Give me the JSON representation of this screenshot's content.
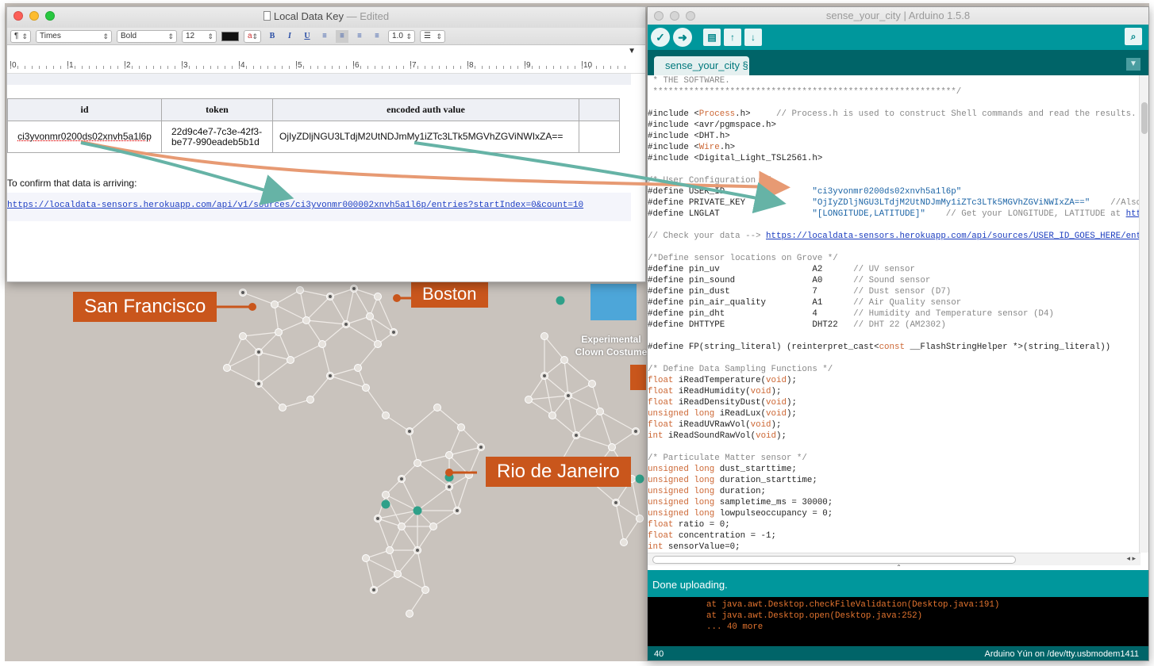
{
  "textedit": {
    "title": "Local Data Key",
    "status": "Edited",
    "format_bar": {
      "paragraph": "¶",
      "font_family": "Times",
      "font_style": "Bold",
      "font_size": "12",
      "bold": "B",
      "italic": "I",
      "underline": "U",
      "line_spacing": "1.0"
    },
    "ruler_numbers": [
      "0",
      "1",
      "2",
      "3",
      "4",
      "5",
      "6",
      "7",
      "8",
      "9",
      "10"
    ],
    "table": {
      "headers": [
        "id",
        "token",
        "encoded auth value",
        ""
      ],
      "row": [
        "ci3yvonmr0200ds02xnvh5a1l6p",
        "22d9c4e7-7c3e-42f3-be77-990eadeb5b1d",
        "OjIyZDljNGU3LTdjM2UtNDJmMy1iZTc3LTk5MGVhZGViNWIxZA==",
        ""
      ]
    },
    "confirm_text": "To confirm that data is arriving:",
    "confirm_link": "https://localdata-sensors.herokuapp.com/api/v1/sources/ci3yvonmr000002xnvh5a1l6p/entries?startIndex=0&count=10"
  },
  "map": {
    "labels": [
      "San Francisco",
      "Boston",
      "Rio de Janeiro"
    ],
    "note_line1": "Experimental",
    "note_line2": "Clown Costume",
    "colors": {
      "callout": "#c9561c",
      "background": "#c9c3bd",
      "node": "#e6e2dd",
      "node_dark": "#5a5a5a",
      "teal": "#2fa089"
    }
  },
  "arduino": {
    "title": "sense_your_city | Arduino 1.5.8",
    "tab": "sense_your_city §",
    "toolbar": [
      "verify-icon",
      "upload-icon",
      "new-icon",
      "open-icon",
      "save-icon",
      "serial-monitor-icon"
    ],
    "code_lines": [
      [
        {
          "t": " * THE SOFTWARE.",
          "c": "#888"
        }
      ],
      [
        {
          "t": " ***********************************************************/",
          "c": "#888"
        }
      ],
      [
        {
          "t": "",
          "c": "#222"
        }
      ],
      [
        {
          "t": "#include <",
          "c": "#222"
        },
        {
          "t": "Process",
          "c": "#cc6633"
        },
        {
          "t": ".h>     ",
          "c": "#222"
        },
        {
          "t": "// Process.h is used to construct Shell commands and read the results.",
          "c": "#888"
        }
      ],
      [
        {
          "t": "#include <avr/pgmspace.h>",
          "c": "#222"
        }
      ],
      [
        {
          "t": "#include <DHT.h>",
          "c": "#222"
        }
      ],
      [
        {
          "t": "#include <",
          "c": "#222"
        },
        {
          "t": "Wire",
          "c": "#cc6633"
        },
        {
          "t": ".h>",
          "c": "#222"
        }
      ],
      [
        {
          "t": "#include <Digital_Light_TSL2561.h>",
          "c": "#222"
        }
      ],
      [
        {
          "t": "",
          "c": "#222"
        }
      ],
      [
        {
          "t": "/* User Configuration */",
          "c": "#888"
        }
      ],
      [
        {
          "t": "#define USER_ID                 ",
          "c": "#222"
        },
        {
          "t": "\"ci3yvonmr0200ds02xnvh5a1l6p\"",
          "c": "#1a63a5"
        }
      ],
      [
        {
          "t": "#define PRIVATE_KEY             ",
          "c": "#222"
        },
        {
          "t": "\"OjIyZDljNGU3LTdjM2UtNDJmMy1iZTc3LTk5MGVhZGViNWIxZA==\"",
          "c": "#1a63a5"
        },
        {
          "t": "    //Also known as \"",
          "c": "#888"
        }
      ],
      [
        {
          "t": "#define LNGLAT                  ",
          "c": "#222"
        },
        {
          "t": "\"[LONGITUDE,LATITUDE]\"",
          "c": "#1a63a5"
        },
        {
          "t": "    // Get your LONGITUDE, LATITUDE at ",
          "c": "#888"
        },
        {
          "t": "http://mygeopo",
          "c": "#1a3cbf",
          "u": true
        }
      ],
      [
        {
          "t": "",
          "c": "#222"
        }
      ],
      [
        {
          "t": "// Check your data --> ",
          "c": "#888"
        },
        {
          "t": "https://localdata-sensors.herokuapp.com/api/sources/USER_ID_GOES_HERE/entries?st",
          "c": "#1a3cbf",
          "u": true
        }
      ],
      [
        {
          "t": "",
          "c": "#222"
        }
      ],
      [
        {
          "t": "/*Define sensor locations on Grove */",
          "c": "#888"
        }
      ],
      [
        {
          "t": "#define pin_uv                  A2      ",
          "c": "#222"
        },
        {
          "t": "// UV sensor",
          "c": "#888"
        }
      ],
      [
        {
          "t": "#define pin_sound               A0      ",
          "c": "#222"
        },
        {
          "t": "// Sound sensor",
          "c": "#888"
        }
      ],
      [
        {
          "t": "#define pin_dust                7       ",
          "c": "#222"
        },
        {
          "t": "// Dust sensor (D7)",
          "c": "#888"
        }
      ],
      [
        {
          "t": "#define pin_air_quality         A1      ",
          "c": "#222"
        },
        {
          "t": "// Air Quality sensor",
          "c": "#888"
        }
      ],
      [
        {
          "t": "#define pin_dht                 4       ",
          "c": "#222"
        },
        {
          "t": "// Humidity and Temperature sensor (D4)",
          "c": "#888"
        }
      ],
      [
        {
          "t": "#define DHTTYPE                 DHT22   ",
          "c": "#222"
        },
        {
          "t": "// DHT 22 (AM2302)",
          "c": "#888"
        }
      ],
      [
        {
          "t": "",
          "c": "#222"
        }
      ],
      [
        {
          "t": "#define FP(string_literal) (reinterpret_cast<",
          "c": "#222"
        },
        {
          "t": "const",
          "c": "#cc6633"
        },
        {
          "t": " __FlashStringHelper *>(string_literal))",
          "c": "#222"
        }
      ],
      [
        {
          "t": "",
          "c": "#222"
        }
      ],
      [
        {
          "t": "/* Define Data Sampling Functions */",
          "c": "#888"
        }
      ],
      [
        {
          "t": "float",
          "c": "#cc6633"
        },
        {
          "t": " iReadTemperature(",
          "c": "#222"
        },
        {
          "t": "void",
          "c": "#cc6633"
        },
        {
          "t": ");",
          "c": "#222"
        }
      ],
      [
        {
          "t": "float",
          "c": "#cc6633"
        },
        {
          "t": " iReadHumidity(",
          "c": "#222"
        },
        {
          "t": "void",
          "c": "#cc6633"
        },
        {
          "t": ");",
          "c": "#222"
        }
      ],
      [
        {
          "t": "float",
          "c": "#cc6633"
        },
        {
          "t": " iReadDensityDust(",
          "c": "#222"
        },
        {
          "t": "void",
          "c": "#cc6633"
        },
        {
          "t": ");",
          "c": "#222"
        }
      ],
      [
        {
          "t": "unsigned long",
          "c": "#cc6633"
        },
        {
          "t": " iReadLux(",
          "c": "#222"
        },
        {
          "t": "void",
          "c": "#cc6633"
        },
        {
          "t": ");",
          "c": "#222"
        }
      ],
      [
        {
          "t": "float",
          "c": "#cc6633"
        },
        {
          "t": " iReadUVRawVol(",
          "c": "#222"
        },
        {
          "t": "void",
          "c": "#cc6633"
        },
        {
          "t": ");",
          "c": "#222"
        }
      ],
      [
        {
          "t": "int",
          "c": "#cc6633"
        },
        {
          "t": " iReadSoundRawVol(",
          "c": "#222"
        },
        {
          "t": "void",
          "c": "#cc6633"
        },
        {
          "t": ");",
          "c": "#222"
        }
      ],
      [
        {
          "t": "",
          "c": "#222"
        }
      ],
      [
        {
          "t": "/* Particulate Matter sensor */",
          "c": "#888"
        }
      ],
      [
        {
          "t": "unsigned long",
          "c": "#cc6633"
        },
        {
          "t": " dust_starttime;",
          "c": "#222"
        }
      ],
      [
        {
          "t": "unsigned long",
          "c": "#cc6633"
        },
        {
          "t": " duration_starttime;",
          "c": "#222"
        }
      ],
      [
        {
          "t": "unsigned long",
          "c": "#cc6633"
        },
        {
          "t": " duration;",
          "c": "#222"
        }
      ],
      [
        {
          "t": "unsigned long",
          "c": "#cc6633"
        },
        {
          "t": " sampletime_ms = 30000;",
          "c": "#222"
        }
      ],
      [
        {
          "t": "unsigned long",
          "c": "#cc6633"
        },
        {
          "t": " lowpulseoccupancy = 0;",
          "c": "#222"
        }
      ],
      [
        {
          "t": "float",
          "c": "#cc6633"
        },
        {
          "t": " ratio = 0;",
          "c": "#222"
        }
      ],
      [
        {
          "t": "float",
          "c": "#cc6633"
        },
        {
          "t": " concentration = -1;",
          "c": "#222"
        }
      ],
      [
        {
          "t": "int",
          "c": "#cc6633"
        },
        {
          "t": " sensorValue=0;",
          "c": "#222"
        }
      ]
    ],
    "status": "Done uploading.",
    "console_lines": [
      "at java.awt.Desktop.checkFileValidation(Desktop.java:191)",
      "at java.awt.Desktop.open(Desktop.java:252)",
      "... 40 more"
    ],
    "line_number": "40",
    "board": "Arduino Yún on /dev/tty.usbmodem1411",
    "colors": {
      "teal": "#00979c",
      "dark_teal": "#006468",
      "keyword": "#cc6633",
      "string": "#1a63a5",
      "comment": "#888888",
      "console": "#e3742f"
    }
  }
}
